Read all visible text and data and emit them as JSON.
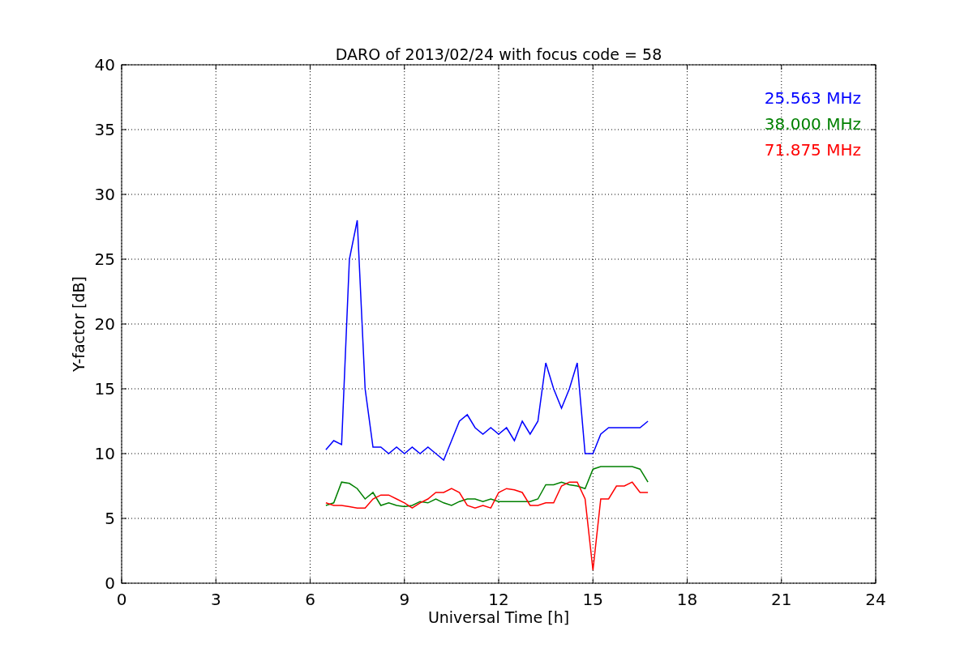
{
  "chart_data": {
    "type": "line",
    "title": "DARO of 2013/02/24 with focus code = 58",
    "xlabel": "Universal Time [h]",
    "ylabel": "Y-factor [dB]",
    "x": [
      6.5,
      6.75,
      7,
      7.25,
      7.5,
      7.75,
      8,
      8.25,
      8.5,
      8.75,
      9,
      9.25,
      9.5,
      9.75,
      10,
      10.25,
      10.5,
      10.75,
      11,
      11.25,
      11.5,
      11.75,
      12,
      12.25,
      12.5,
      12.75,
      13,
      13.25,
      13.5,
      13.75,
      14,
      14.25,
      14.5,
      14.75,
      15,
      15.25,
      15.5,
      15.75,
      16,
      16.25,
      16.5,
      16.75
    ],
    "series": [
      {
        "name": "25.563 MHz",
        "color": "#0000ff",
        "values": [
          10.3,
          11,
          10.7,
          25,
          28,
          15,
          10.5,
          10.5,
          10,
          10.5,
          10,
          10.5,
          10,
          10.5,
          10,
          9.5,
          11,
          12.5,
          13,
          12,
          11.5,
          12,
          11.5,
          12,
          11,
          12.5,
          11.5,
          12.5,
          17,
          15,
          13.5,
          15,
          17,
          10,
          10,
          11.5,
          12,
          12,
          12,
          12,
          12,
          12.5
        ]
      },
      {
        "name": "38.000 MHz",
        "color": "#008000",
        "values": [
          6,
          6.2,
          7.8,
          7.7,
          7.3,
          6.5,
          7,
          6,
          6.2,
          6,
          5.9,
          6,
          6.3,
          6.2,
          6.5,
          6.2,
          6,
          6.3,
          6.5,
          6.5,
          6.3,
          6.5,
          6.3,
          6.3,
          6.3,
          6.3,
          6.3,
          6.5,
          7.6,
          7.6,
          7.8,
          7.6,
          7.5,
          7.3,
          8.8,
          9,
          9,
          9,
          9,
          9,
          8.8,
          7.8
        ]
      },
      {
        "name": "71.875 MHz",
        "color": "#ff0000",
        "values": [
          6.2,
          6,
          6,
          5.9,
          5.8,
          5.8,
          6.5,
          6.8,
          6.8,
          6.5,
          6.2,
          5.8,
          6.2,
          6.5,
          7,
          7,
          7.3,
          7,
          6,
          5.8,
          6,
          5.8,
          7,
          7.3,
          7.2,
          7,
          6,
          6,
          6.2,
          6.2,
          7.5,
          7.8,
          7.8,
          6.5,
          1,
          6.5,
          6.5,
          7.5,
          7.5,
          7.8,
          7,
          7
        ]
      }
    ],
    "xlim": [
      0,
      24
    ],
    "ylim": [
      0,
      40
    ],
    "xticks": [
      0,
      3,
      6,
      9,
      12,
      15,
      18,
      21,
      24
    ],
    "yticks": [
      0,
      5,
      10,
      15,
      20,
      25,
      30,
      35,
      40
    ],
    "grid": true
  }
}
